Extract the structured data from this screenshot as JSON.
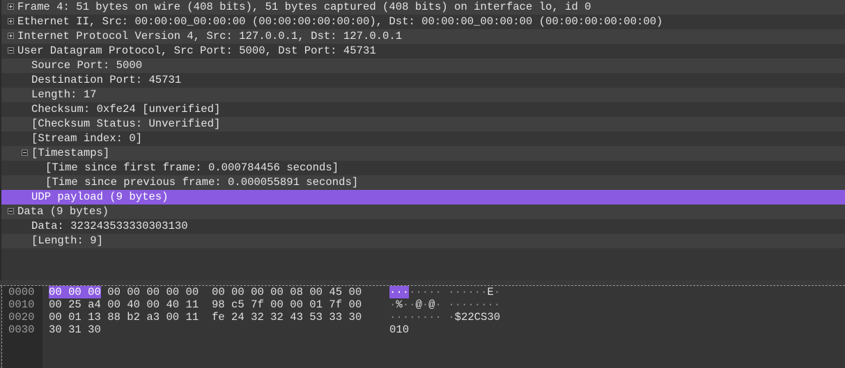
{
  "tree": [
    {
      "text": "Frame 4: 51 bytes on wire (408 bits), 51 bytes captured (408 bits) on interface lo, id 0",
      "level": 0,
      "expander": "plus"
    },
    {
      "text": "Ethernet II, Src: 00:00:00_00:00:00 (00:00:00:00:00:00), Dst: 00:00:00_00:00:00 (00:00:00:00:00:00)",
      "level": 0,
      "expander": "plus"
    },
    {
      "text": "Internet Protocol Version 4, Src: 127.0.0.1, Dst: 127.0.0.1",
      "level": 0,
      "expander": "plus"
    },
    {
      "text": "User Datagram Protocol, Src Port: 5000, Dst Port: 45731",
      "level": 0,
      "expander": "minus"
    },
    {
      "text": "Source Port: 5000",
      "level": 1,
      "expander": ""
    },
    {
      "text": "Destination Port: 45731",
      "level": 1,
      "expander": ""
    },
    {
      "text": "Length: 17",
      "level": 1,
      "expander": ""
    },
    {
      "text": "Checksum: 0xfe24 [unverified]",
      "level": 1,
      "expander": ""
    },
    {
      "text": "[Checksum Status: Unverified]",
      "level": 1,
      "expander": ""
    },
    {
      "text": "[Stream index: 0]",
      "level": 1,
      "expander": ""
    },
    {
      "text": "[Timestamps]",
      "level": 1,
      "expander": "minus"
    },
    {
      "text": "[Time since first frame: 0.000784456 seconds]",
      "level": 2,
      "expander": ""
    },
    {
      "text": "[Time since previous frame: 0.000055891 seconds]",
      "level": 2,
      "expander": ""
    },
    {
      "text": "UDP payload (9 bytes)",
      "level": 1,
      "expander": "",
      "selected": true
    },
    {
      "text": "Data (9 bytes)",
      "level": 0,
      "expander": "minus"
    },
    {
      "text": "Data: 323243533330303130",
      "level": 1,
      "expander": ""
    },
    {
      "text": "[Length: 9]",
      "level": 1,
      "expander": ""
    }
  ],
  "hex": {
    "rows": [
      {
        "offset": "0000",
        "bytes_hl": "00 00 00",
        "bytes": " 00 00 00 00 00  00 00 00 00 08 00 45 00",
        "ascii_hl": "···",
        "ascii": "····· ······E·"
      },
      {
        "offset": "0010",
        "bytes_hl": "",
        "bytes": "00 25 a4 00 40 00 40 11  98 c5 7f 00 00 01 7f 00",
        "ascii_hl": "",
        "ascii": "·%··@·@· ········"
      },
      {
        "offset": "0020",
        "bytes_hl": "",
        "bytes": "00 01 13 88 b2 a3 00 11  fe 24 32 32 43 53 33 30",
        "ascii_hl": "",
        "ascii": "········ ·$22CS30"
      },
      {
        "offset": "0030",
        "bytes_hl": "",
        "bytes": "30 31 30",
        "ascii_hl": "",
        "ascii": "010"
      }
    ]
  },
  "colors": {
    "selection": "#8a5be0",
    "background": "#363636",
    "alt_row": "#404040"
  }
}
